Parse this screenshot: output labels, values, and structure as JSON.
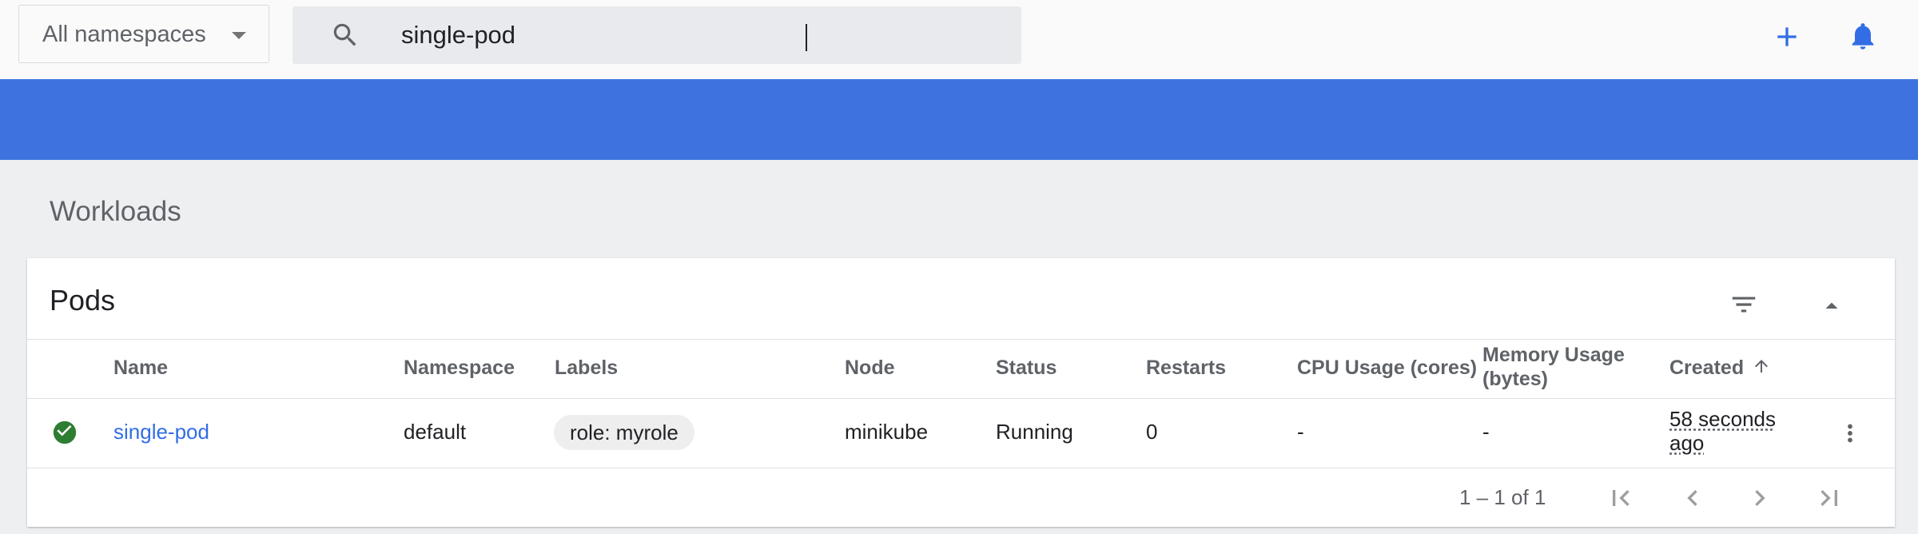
{
  "toolbar": {
    "namespace_selected": "All namespaces",
    "search_value": "single-pod",
    "create_icon": "plus-icon",
    "notifications_icon": "bell-icon",
    "accent_color": "#326de6"
  },
  "banner": {
    "color": "#3e73df"
  },
  "page": {
    "title": "Workloads"
  },
  "pods": {
    "title": "Pods",
    "filter_icon": "filter-icon",
    "collapse_icon": "chevron-up-icon",
    "columns": {
      "name": "Name",
      "namespace": "Namespace",
      "labels": "Labels",
      "node": "Node",
      "status": "Status",
      "restarts": "Restarts",
      "cpu": "CPU Usage (cores)",
      "memory_line1": "Memory Usage",
      "memory_line2": "(bytes)",
      "created": "Created"
    },
    "rows": [
      {
        "status_icon": "check-circle-icon",
        "status_color": "#2e7d32",
        "name": "single-pod",
        "namespace": "default",
        "label": "role: myrole",
        "node": "minikube",
        "status": "Running",
        "restarts": "0",
        "cpu": "-",
        "memory": "-",
        "created": "58 seconds ago"
      }
    ],
    "pagination": {
      "range": "1 – 1 of 1"
    }
  }
}
